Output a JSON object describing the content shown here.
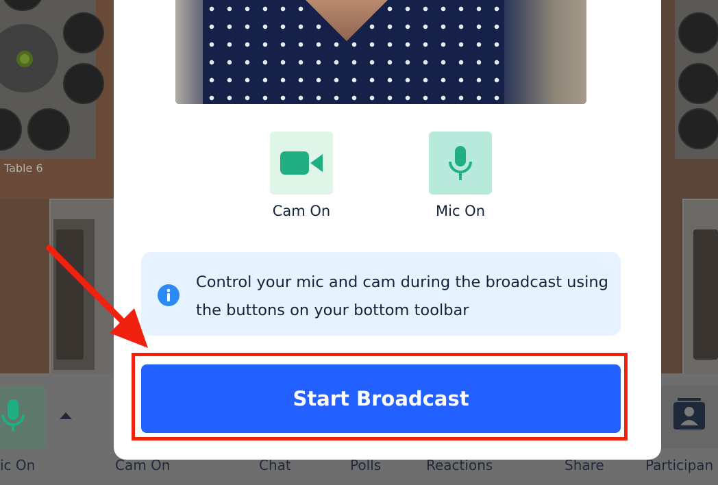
{
  "background": {
    "table_label": "Table 6",
    "toolbar": {
      "items": [
        {
          "label": "ic On"
        },
        {
          "label": "Cam On"
        },
        {
          "label": "Chat"
        },
        {
          "label": "Polls"
        },
        {
          "label": "Reactions"
        },
        {
          "label": "Share"
        },
        {
          "label": "Participan"
        }
      ]
    }
  },
  "modal": {
    "controls": {
      "cam_label": "Cam On",
      "mic_label": "Mic On"
    },
    "info_text": "Control your mic and cam during the broadcast using the buttons on your bottom toolbar",
    "start_button_label": "Start Broadcast"
  },
  "icons": {
    "cam": "video-camera-icon",
    "mic": "microphone-icon",
    "info": "info-circle-icon",
    "participants": "participants-icon"
  },
  "colors": {
    "primary_button": "#2260ff",
    "highlight_border": "#f0220f",
    "annotation_arrow": "#f0220f",
    "icon_green": "#21ae83",
    "info_background": "#e6f2ff",
    "info_icon": "#2b8af5"
  }
}
